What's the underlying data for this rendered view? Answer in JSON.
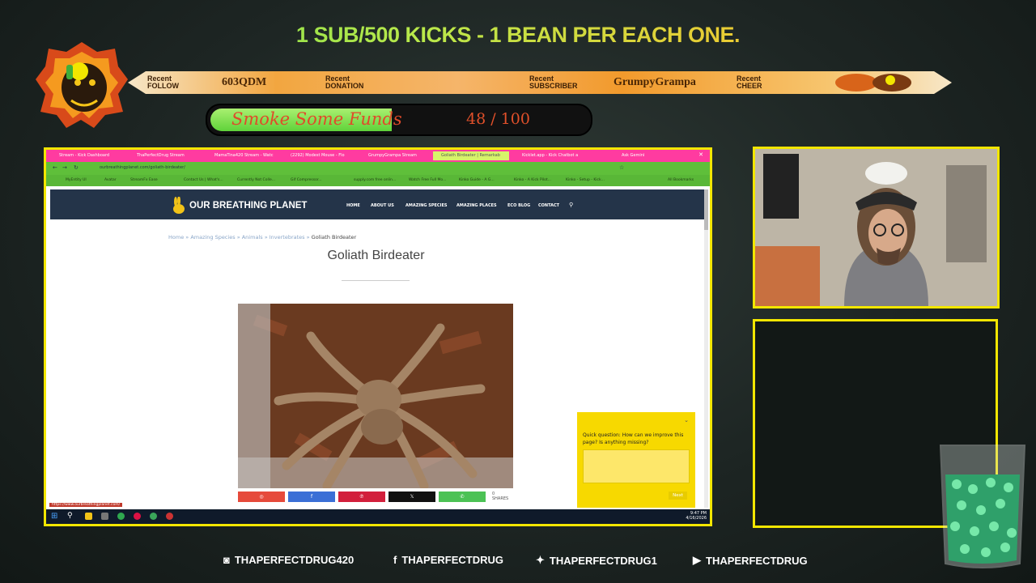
{
  "overlay": {
    "banner": "1 SUB/500 KICKS - 1 BEAN PER EACH ONE.",
    "ticker": [
      {
        "label1": "Recent",
        "label2": "FOLLOW",
        "value": "603QDM"
      },
      {
        "label1": "Recent",
        "label2": "DONATION",
        "value": ""
      },
      {
        "label1": "Recent",
        "label2": "SUBSCRIBER",
        "value": "GrumpyGrampa"
      },
      {
        "label1": "Recent",
        "label2": "CHEER",
        "value": ""
      }
    ],
    "funds": {
      "label": "Smoke Some Funds",
      "current": 48,
      "goal": 100,
      "count_text": "48 / 100"
    },
    "social": [
      {
        "icon": "instagram-icon",
        "handle": "THAPERFECTDRUG420"
      },
      {
        "icon": "facebook-icon",
        "handle": "THAPERFECTDRUG"
      },
      {
        "icon": "twitter-icon",
        "handle": "THAPERFECTDRUG1"
      },
      {
        "icon": "youtube-icon",
        "handle": "THAPERFECTDRUG"
      }
    ]
  },
  "browser": {
    "tabs": [
      "Stream - Kick Dashboard",
      "ThaPerfectDrug Stream",
      "MamaTina420 Stream - Watc",
      "(2292) Modest Mouse - Flo",
      "GrumpyGrampa Stream",
      "Goliath Birdeater | Remarkab",
      "Kicklet.app - Kick Chatbot a"
    ],
    "ask_button": "Ask Gemini",
    "address": "ourbreathingplanet.com/goliath-birdeater/",
    "bookmarks": [
      "MyEntity UI",
      "Avatar",
      "StreamFx Ease",
      "Contact Us | What's...",
      "Currently Not Colle...",
      "Gif Compressor...",
      "supply.com free onlin...",
      "Watch Free Full Mo...",
      "Kinko Guide - A G...",
      "Kinko - A Kick Pilot...",
      "Kinko - Setup - Kick...",
      "All Bookmarks"
    ],
    "status_url": "https://www.ourbreathingplanet.com/",
    "clock": {
      "time": "9:47 PM",
      "date": "4/16/2026"
    }
  },
  "site": {
    "logo": "OUR BREATHING PLANET",
    "nav": [
      "HOME",
      "ABOUT US",
      "AMAZING SPECIES",
      "AMAZING PLACES",
      "ECO BLOG",
      "CONTACT"
    ],
    "breadcrumb": [
      "Home",
      "Amazing Species",
      "Animals",
      "Invertebrates"
    ],
    "breadcrumb_current": "Goliath Birdeater",
    "title": "Goliath Birdeater",
    "share_count": "0",
    "share_label": "SHARES",
    "survey": {
      "question": "Quick question: How can we improve this page? Is anything missing?",
      "next": "Next"
    }
  }
}
